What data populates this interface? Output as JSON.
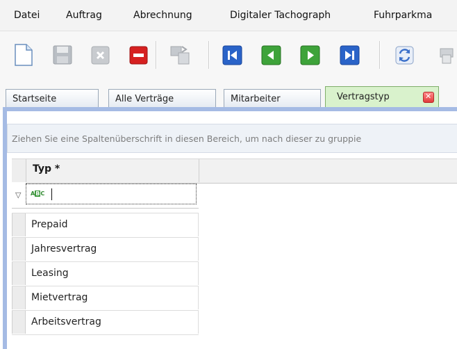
{
  "menu": {
    "items": [
      {
        "label": "Datei"
      },
      {
        "label": "Auftrag"
      },
      {
        "label": "Abrechnung"
      },
      {
        "label": "Digitaler Tachograph"
      },
      {
        "label": "Fuhrparkma"
      }
    ]
  },
  "toolbar": {
    "buttons": [
      {
        "icon": "new-document-icon",
        "state": "enabled"
      },
      {
        "icon": "save-icon",
        "state": "disabled"
      },
      {
        "icon": "cancel-icon",
        "state": "disabled"
      },
      {
        "icon": "delete-icon",
        "state": "enabled"
      },
      {
        "icon": "copy-icon",
        "state": "disabled"
      },
      {
        "icon": "first-record-icon",
        "state": "enabled"
      },
      {
        "icon": "previous-record-icon",
        "state": "enabled"
      },
      {
        "icon": "next-record-icon",
        "state": "enabled"
      },
      {
        "icon": "last-record-icon",
        "state": "enabled"
      },
      {
        "icon": "refresh-icon",
        "state": "enabled"
      },
      {
        "icon": "print-icon",
        "state": "disabled"
      }
    ]
  },
  "tabs": [
    {
      "label": "Startseite",
      "active": false
    },
    {
      "label": "Alle Verträge",
      "active": false
    },
    {
      "label": "Mitarbeiter",
      "active": false
    },
    {
      "label": "Vertragstyp",
      "active": true,
      "closable": true
    }
  ],
  "grid": {
    "group_hint": "Ziehen Sie eine Spaltenüberschrift in diesen Bereich, um nach dieser zu gruppie",
    "column_header": "Typ *",
    "filter_value": "",
    "rows": [
      {
        "typ": "Prepaid"
      },
      {
        "typ": "Jahresvertrag"
      },
      {
        "typ": "Leasing"
      },
      {
        "typ": "Mietvertrag"
      },
      {
        "typ": "Arbeitsvertrag"
      }
    ]
  },
  "colors": {
    "active_tab": "#d9f2cc",
    "panel_border": "#a5bbe4",
    "nav_blue": "#2a63c8",
    "nav_green": "#3ea33a",
    "delete_red": "#d62020"
  }
}
